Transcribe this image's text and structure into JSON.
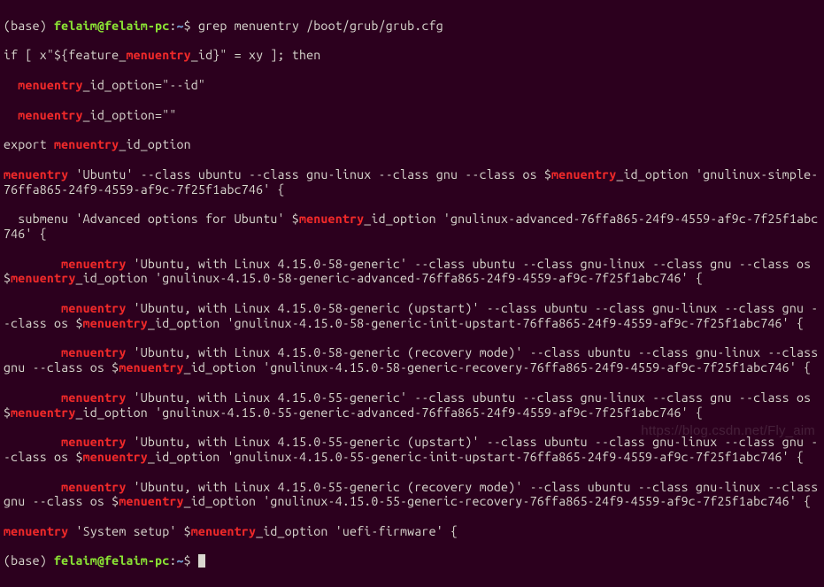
{
  "prompt": {
    "base": "(base) ",
    "userhost": "felaim@felaim-pc",
    "colon": ":",
    "path": "~",
    "dollar": "$ "
  },
  "cmd": "grep menuentry /boot/grub/grub.cfg",
  "hl": "menuentry",
  "out": {
    "l1a": "if [ x\"${feature_",
    "l1b": "_id}\" = xy ]; then",
    "l2b": "_id_option=\"--id\"",
    "indent2": "  ",
    "l3b": "_id_option=\"\"",
    "l4a": "export ",
    "l4b": "_id_option",
    "l5b": " 'Ubuntu' --class ubuntu --class gnu-linux --class gnu --class os $",
    "l5c": "_id_option 'gnulinux-simple-76ffa865-24f9-4559-af9c-7f25f1abc746' {",
    "l6a": "  submenu 'Advanced options for Ubuntu' $",
    "l6b": "_id_option 'gnulinux-advanced-76ffa865-24f9-4559-af9c-7f25f1abc746' {",
    "indent8": "        ",
    "l7b": " 'Ubuntu, with Linux 4.15.0-58-generic' --class ubuntu --class gnu-linux --class gnu --class os $",
    "l7c": "_id_option 'gnulinux-4.15.0-58-generic-advanced-76ffa865-24f9-4559-af9c-7f25f1abc746' {",
    "l8b": " 'Ubuntu, with Linux 4.15.0-58-generic (upstart)' --class ubuntu --class gnu-linux --class gnu --class os $",
    "l8c": "_id_option 'gnulinux-4.15.0-58-generic-init-upstart-76ffa865-24f9-4559-af9c-7f25f1abc746' {",
    "l9b": " 'Ubuntu, with Linux 4.15.0-58-generic (recovery mode)' --class ubuntu --class gnu-linux --class gnu --class os $",
    "l9c": "_id_option 'gnulinux-4.15.0-58-generic-recovery-76ffa865-24f9-4559-af9c-7f25f1abc746' {",
    "l10b": " 'Ubuntu, with Linux 4.15.0-55-generic' --class ubuntu --class gnu-linux --class gnu --class os $",
    "l10c": "_id_option 'gnulinux-4.15.0-55-generic-advanced-76ffa865-24f9-4559-af9c-7f25f1abc746' {",
    "l11b": " 'Ubuntu, with Linux 4.15.0-55-generic (upstart)' --class ubuntu --class gnu-linux --class gnu --class os $",
    "l11c": "_id_option 'gnulinux-4.15.0-55-generic-init-upstart-76ffa865-24f9-4559-af9c-7f25f1abc746' {",
    "l12b": " 'Ubuntu, with Linux 4.15.0-55-generic (recovery mode)' --class ubuntu --class gnu-linux --class gnu --class os $",
    "l12c": "_id_option 'gnulinux-4.15.0-55-generic-recovery-76ffa865-24f9-4559-af9c-7f25f1abc746' {",
    "l13b": " 'System setup' $",
    "l13c": "_id_option 'uefi-firmware' {"
  },
  "watermark": "https://blog.csdn.net/Fly_aim"
}
